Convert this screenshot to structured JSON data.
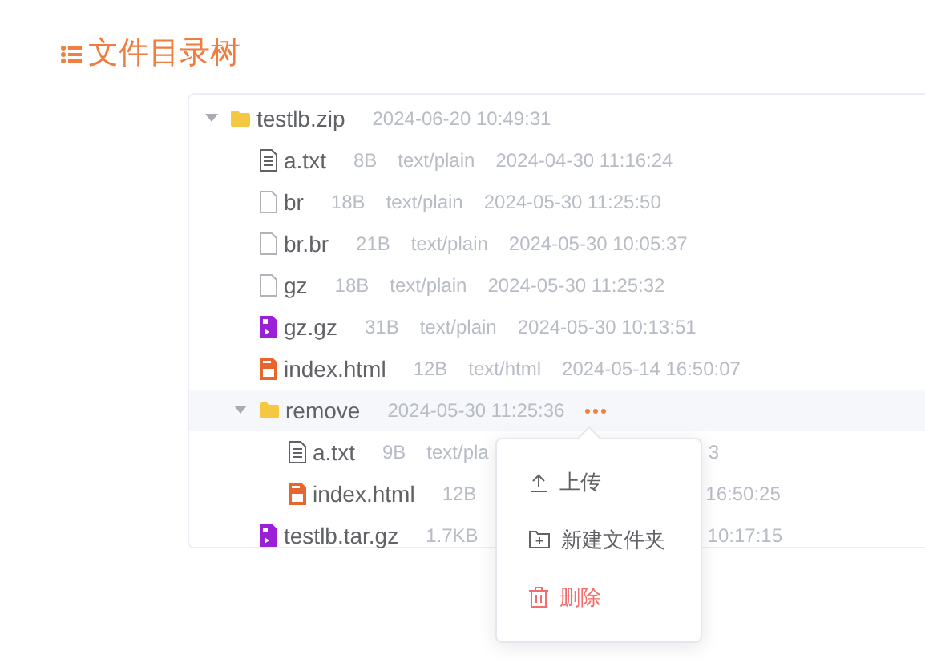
{
  "title": "文件目录树",
  "tree": [
    {
      "name": "testlb.zip",
      "kind": "folder",
      "expanded": true,
      "time": "2024-06-20 10:49:31",
      "children": [
        {
          "name": "a.txt",
          "kind": "text",
          "size": "8B",
          "type": "text/plain",
          "time": "2024-04-30 11:16:24"
        },
        {
          "name": "br",
          "kind": "blank",
          "size": "18B",
          "type": "text/plain",
          "time": "2024-05-30 11:25:50"
        },
        {
          "name": "br.br",
          "kind": "blank",
          "size": "21B",
          "type": "text/plain",
          "time": "2024-05-30 10:05:37"
        },
        {
          "name": "gz",
          "kind": "blank",
          "size": "18B",
          "type": "text/plain",
          "time": "2024-05-30 11:25:32"
        },
        {
          "name": "gz.gz",
          "kind": "archive",
          "size": "31B",
          "type": "text/plain",
          "time": "2024-05-30 10:13:51"
        },
        {
          "name": "index.html",
          "kind": "html",
          "size": "12B",
          "type": "text/html",
          "time": "2024-05-14 16:50:07"
        },
        {
          "name": "remove",
          "kind": "folder",
          "expanded": true,
          "selected": true,
          "time": "2024-05-30 11:25:36",
          "children": [
            {
              "name": "a.txt",
              "kind": "text",
              "size": "9B",
              "type": "text/pla",
              "time": "3",
              "covered": true
            },
            {
              "name": "index.html",
              "kind": "html",
              "size": "12B",
              "time": "16:50:25",
              "covered": true
            }
          ]
        },
        {
          "name": "testlb.tar.gz",
          "kind": "archive",
          "size": "1.7KB",
          "time": "10:17:15",
          "covered": true
        }
      ]
    }
  ],
  "menu": [
    {
      "label": "上传",
      "kind": "upload",
      "danger": false
    },
    {
      "label": "新建文件夹",
      "kind": "new-folder",
      "danger": false
    },
    {
      "label": "删除",
      "kind": "delete",
      "danger": true
    }
  ]
}
